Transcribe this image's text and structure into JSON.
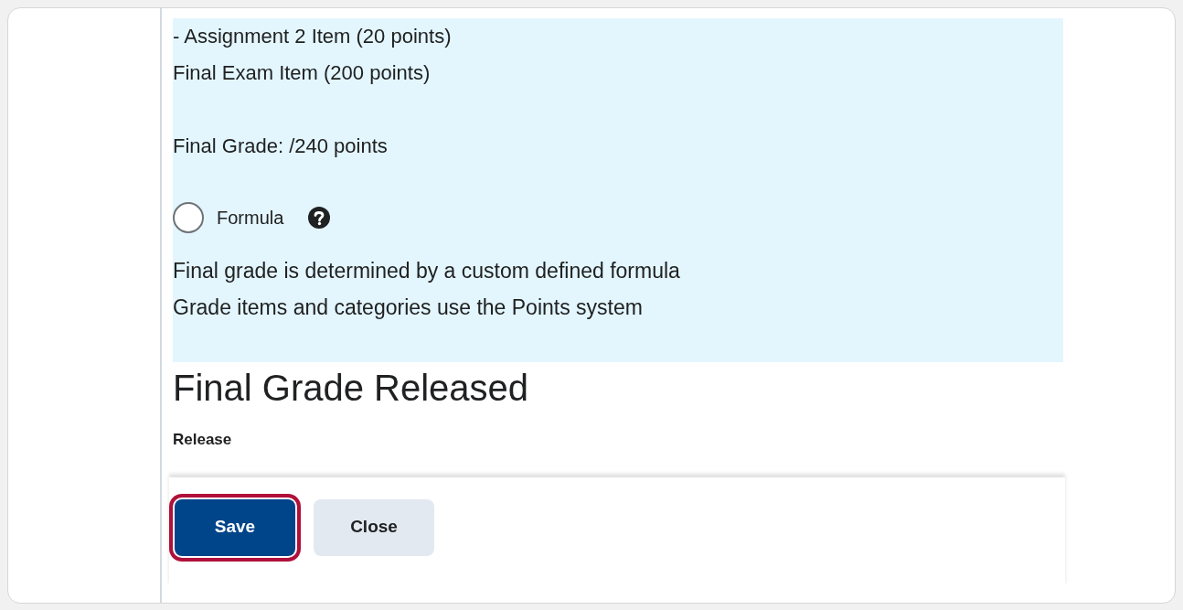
{
  "grading_info": {
    "lines": [
      "- Assignment 2 Item (20 points)",
      "Final Exam Item (200 points)"
    ],
    "total": "Final Grade: /240 points",
    "option": {
      "label": "Formula",
      "selected": false
    },
    "description": [
      "Final grade is determined by a custom defined formula",
      "Grade items and categories use the Points system"
    ]
  },
  "section": {
    "heading": "Final Grade Released",
    "field_label": "Release"
  },
  "buttons": [
    {
      "label": "Save",
      "kind": "primary",
      "highlighted": true
    },
    {
      "label": "Close",
      "kind": "secondary",
      "highlighted": false
    }
  ]
}
